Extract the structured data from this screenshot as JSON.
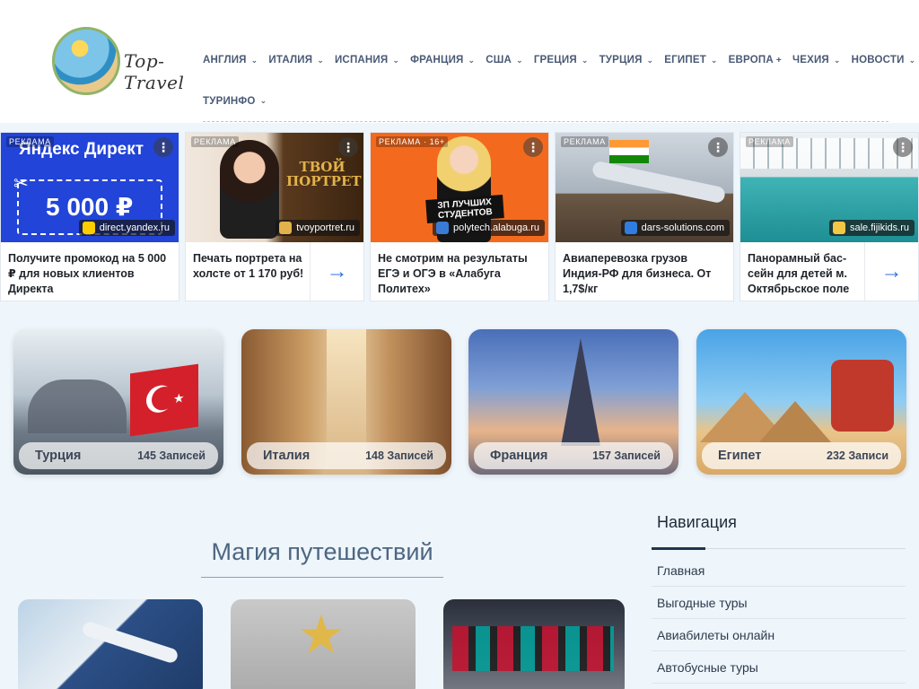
{
  "header": {
    "logo_text": "Top-Travel",
    "nav": [
      {
        "label": "АНГЛИЯ",
        "chevron": true
      },
      {
        "label": "ИТАЛИЯ",
        "chevron": true
      },
      {
        "label": "ИСПАНИЯ",
        "chevron": true
      },
      {
        "label": "ФРАНЦИЯ",
        "chevron": true
      },
      {
        "label": "США",
        "chevron": true
      },
      {
        "label": "ГРЕЦИЯ",
        "chevron": true
      },
      {
        "label": "ТУРЦИЯ",
        "chevron": true
      },
      {
        "label": "ЕГИПЕТ",
        "chevron": true
      },
      {
        "label": "ЕВРОПА",
        "plus": "+"
      },
      {
        "label": "ЧЕХИЯ",
        "chevron": true
      },
      {
        "label": "НОВОСТИ",
        "chevron": true
      }
    ],
    "nav_row2": [
      {
        "label": "ТУРИНФО",
        "chevron": true
      }
    ]
  },
  "ads": [
    {
      "tag": "РЕКЛАМА",
      "domain": "direct.yandex.ru",
      "text": "Получите промокод на 5 000 ₽ для новых клиентов Директа",
      "img_brand": "Яндекс Директ",
      "img_amount": "5 000 ₽",
      "has_arrow": false
    },
    {
      "tag": "РЕКЛАМА",
      "domain": "tvoyportret.ru",
      "text": "Печать портрета на холсте от 1 170 руб!",
      "img_brand": "ТВОЙ ПОРТРЕТ",
      "has_arrow": true
    },
    {
      "tag": "РЕКЛАМА · 16+",
      "domain": "polytech.alabuga.ru",
      "text": "Не смотрим на результаты ЕГЭ и ОГЭ в «Алабуга Политех»",
      "img_caption": "ЗП ЛУЧШИХ СТУДЕНТОВ",
      "has_arrow": false
    },
    {
      "tag": "РЕКЛАМА",
      "domain": "dars-solutions.com",
      "text": "Авиаперевозка грузов Индия-РФ для бизнеса. От 1,7$/кг",
      "has_arrow": false
    },
    {
      "tag": "РЕКЛАМА",
      "domain": "sale.fijikids.ru",
      "text": "Панорамный бас­сейн для детей м. Октябрьское поле",
      "has_arrow": true
    }
  ],
  "categories": [
    {
      "name": "Турция",
      "count": "145 Записей"
    },
    {
      "name": "Италия",
      "count": "148 Записей"
    },
    {
      "name": "Франция",
      "count": "157 Записей"
    },
    {
      "name": "Египет",
      "count": "232 Записи"
    }
  ],
  "section": {
    "title": "Магия путешествий"
  },
  "sidebar": {
    "title": "Навигация",
    "items": [
      "Главная",
      "Выгодные туры",
      "Авиабилеты онлайн",
      "Автобусные туры"
    ]
  }
}
